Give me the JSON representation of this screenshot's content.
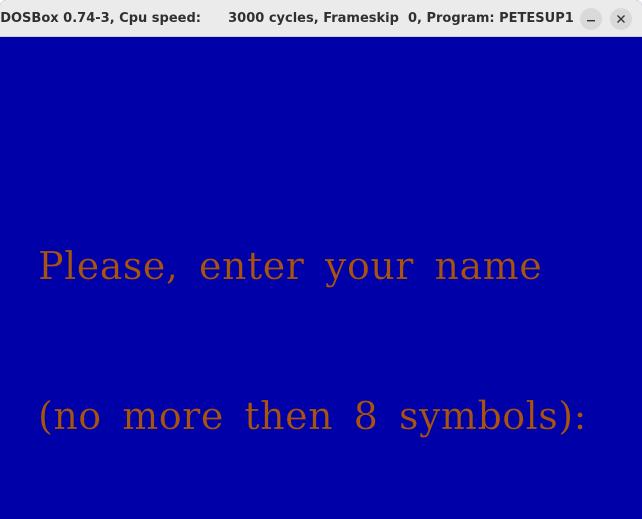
{
  "window": {
    "title": "DOSBox 0.74-3, Cpu speed:      3000 cycles, Frameskip  0, Program: PETESUP1"
  },
  "controls": {
    "minimize_icon": "minimize-icon",
    "close_icon": "close-icon"
  },
  "colors": {
    "screen_background": "#0000a8",
    "prompt_text": "#a8540c",
    "titlebar": "#ebebeb"
  },
  "screen": {
    "prompt_line1": "Please, enter your name",
    "prompt_line2": "(no more then 8 symbols):"
  }
}
